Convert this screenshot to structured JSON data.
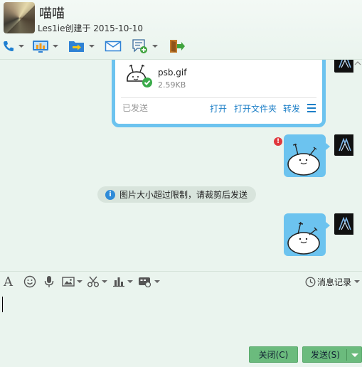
{
  "header": {
    "title": "喵喵",
    "subtitle": "Les1ie创建于 2015-10-10"
  },
  "toolbar": {
    "items": [
      "phone-icon",
      "screen-share-icon",
      "file-transfer-icon",
      "mail-icon",
      "message-add-icon",
      "exit-icon"
    ]
  },
  "chat": {
    "file_card": {
      "file_name": "psb.gif",
      "file_size": "2.59KB",
      "status": "已发送",
      "actions": [
        "打开",
        "打开文件夹",
        "转发"
      ]
    },
    "error_badge": "!",
    "notice": {
      "icon_text": "i",
      "text": "图片大小超过限制，请裁剪后发送"
    }
  },
  "input_toolbar": {
    "font_icon_text": "A",
    "history_label": "消息记录"
  },
  "buttons": {
    "close_label": "关闭(C)",
    "send_label": "发送(S)"
  },
  "colors": {
    "accent": "#6cc3ef",
    "button": "#6bbb7d",
    "background": "#eaf4ee",
    "link": "#1d7fc7"
  }
}
